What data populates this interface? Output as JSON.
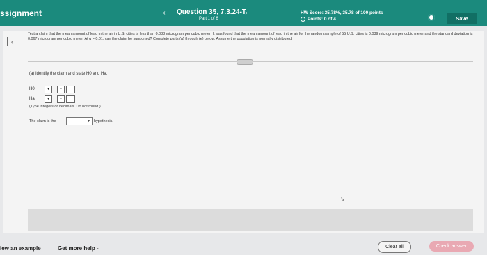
{
  "header": {
    "assignment_title": "ssignment",
    "question_title": "Question 35, 7.3.24-T",
    "question_part": "Part 1 of 6",
    "hw_score": "HW Score: 35.78%, 35.78 of 100 points",
    "points": "Points: 0 of 4",
    "save_label": "Save",
    "prev_icon": "chevron-left-icon",
    "next_icon": "chevron-right-icon",
    "settings_icon": "gear-icon",
    "accent_color": "#1b8a7d"
  },
  "problem": {
    "text": "Test a claim that the mean amount of lead in the air in U.S. cities is less than 0.038 microgram per cubic meter. It was found that the mean amount of lead in the air for the random sample of 55 U.S. cities is 0.039 microgram per cubic meter and the standard deviation is 0.067 microgram per cubic meter. At α = 0.01, can the claim be supported? Complete parts (a) through (e) below. Assume the population is normally distributed.",
    "part_a": "(a) Identify the claim and state H0 and Ha.",
    "h0_label": "H0:",
    "ha_label": "Ha:",
    "hint": "(Type integers or decimals. Do not round.)",
    "claim_prefix": "The claim is the",
    "claim_suffix": "hypothesis."
  },
  "footer": {
    "view_example": "iew an example",
    "more_help": "Get more help -",
    "clear_all": "Clear all",
    "check_answer": "Check answer"
  }
}
